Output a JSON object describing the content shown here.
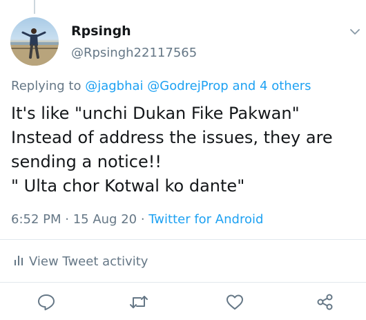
{
  "author": {
    "name": "Rpsingh",
    "handle": "@Rpsingh22117565"
  },
  "reply": {
    "prefix": "Replying to",
    "user1": "@jagbhai",
    "user2": "@GodrejProp",
    "others": "and 4 others"
  },
  "tweet": {
    "lines": [
      "It's like \"unchi Dukan Fike Pakwan\"",
      "Instead of address the issues, they are",
      "sending a notice!!",
      "\" Ulta chor Kotwal ko dante\""
    ]
  },
  "meta": {
    "time": "6:52 PM",
    "sep1": " · ",
    "date": "15 Aug 20",
    "sep2": " · ",
    "client": "Twitter for Android"
  },
  "activity": {
    "label": "View Tweet activity"
  },
  "actions": [
    {
      "name": "reply",
      "icon": "reply-icon"
    },
    {
      "name": "retweet",
      "icon": "retweet-icon"
    },
    {
      "name": "like",
      "icon": "heart-icon"
    },
    {
      "name": "share",
      "icon": "share-icon"
    }
  ],
  "colors": {
    "link": "#1da1f2",
    "secondary_text": "#657786",
    "primary_text": "#14171a",
    "divider": "#e1e8ed"
  }
}
